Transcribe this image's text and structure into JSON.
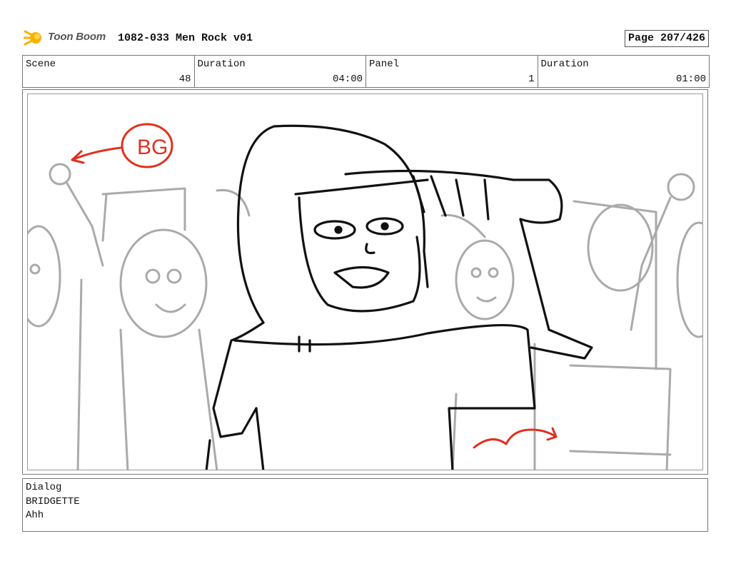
{
  "header": {
    "logo_text": "Toon Boom",
    "doc_title": "1082-033 Men Rock v01",
    "page_label": "Page 207/426"
  },
  "info": {
    "scene_label": "Scene",
    "scene_value": "48",
    "scene_duration_label": "Duration",
    "scene_duration_value": "04:00",
    "panel_label": "Panel",
    "panel_value": "1",
    "panel_duration_label": "Duration",
    "panel_duration_value": "01:00"
  },
  "panel": {
    "annotation_text": "BG"
  },
  "dialog": {
    "label": "Dialog",
    "speaker": "BRIDGETTE",
    "line": "Ahh"
  }
}
